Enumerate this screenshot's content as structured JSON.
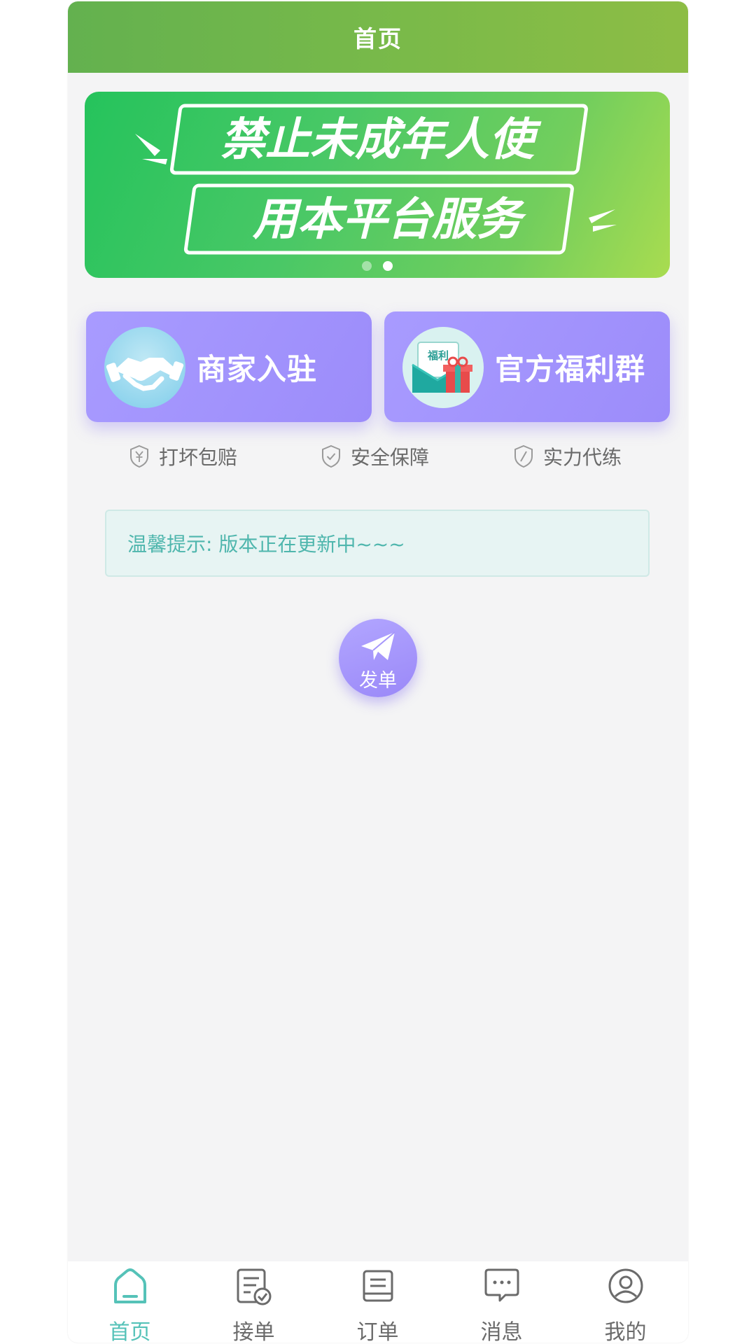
{
  "header": {
    "title": "首页"
  },
  "banner": {
    "line1": "禁止未成年人使",
    "line2": "用本平台服务",
    "slides": 2,
    "active_slide": 2
  },
  "promos": [
    {
      "label": "商家入驻",
      "icon": "handshake-icon"
    },
    {
      "label": "官方福利群",
      "icon": "gift-envelope-icon",
      "icon_text": "福利"
    }
  ],
  "features": [
    {
      "label": "打坏包赔",
      "icon": "yen-shield-icon"
    },
    {
      "label": "安全保障",
      "icon": "check-shield-icon"
    },
    {
      "label": "实力代练",
      "icon": "shield-icon"
    }
  ],
  "notice": {
    "text": "温馨提示: 版本正在更新中~~~"
  },
  "send_button": {
    "label": "发单",
    "icon": "paper-plane-icon"
  },
  "tabbar": {
    "items": [
      {
        "label": "首页",
        "icon": "home-icon",
        "active": true
      },
      {
        "label": "接单",
        "icon": "clipboard-check-icon",
        "active": false
      },
      {
        "label": "订单",
        "icon": "order-list-icon",
        "active": false
      },
      {
        "label": "消息",
        "icon": "message-icon",
        "active": false
      },
      {
        "label": "我的",
        "icon": "user-icon",
        "active": false
      }
    ]
  },
  "colors": {
    "header": "#7ab84a",
    "banner": "#49c866",
    "promo": "#a393fd",
    "notice_text": "#4fb6ad",
    "tab_active": "#55c2b8"
  }
}
